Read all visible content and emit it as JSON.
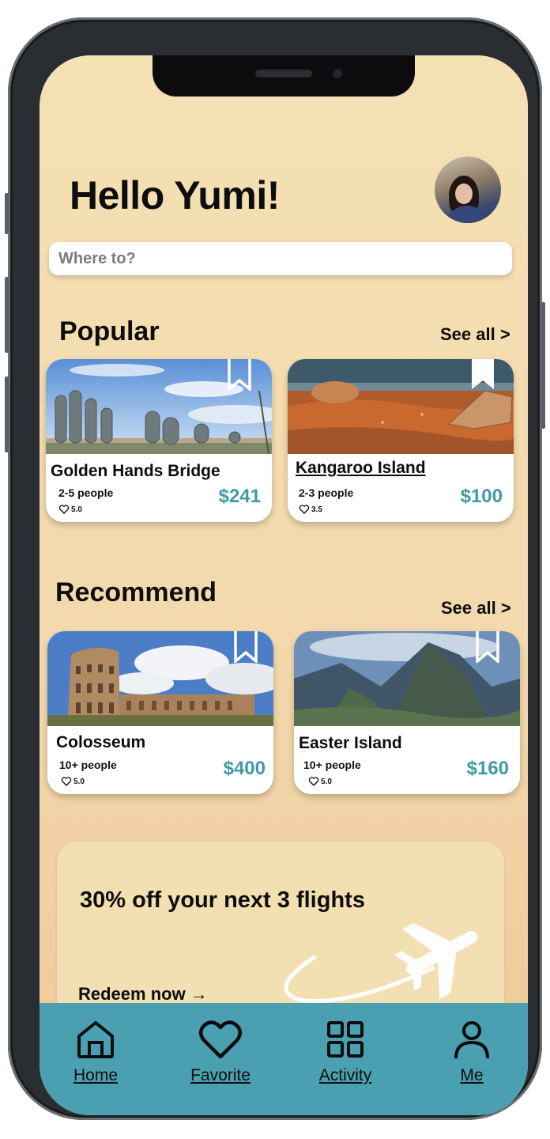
{
  "header": {
    "greeting": "Hello Yumi!"
  },
  "search": {
    "placeholder": "Where to?"
  },
  "popular": {
    "title": "Popular",
    "see_all": "See all >",
    "cards": [
      {
        "name": "Golden Hands Bridge",
        "people": "2-5 people",
        "rating": "5.0",
        "price": "$241"
      },
      {
        "name": "Kangaroo Island",
        "people": "2-3 people",
        "rating": "3.5",
        "price": "$100"
      }
    ]
  },
  "recommend": {
    "title": "Recommend",
    "see_all": "See all >",
    "cards": [
      {
        "name": "Colosseum",
        "people": "10+ people",
        "rating": "5.0",
        "price": "$400"
      },
      {
        "name": "Easter Island",
        "people": "10+ people",
        "rating": "5.0",
        "price": "$160"
      }
    ]
  },
  "promo": {
    "title": "30% off your next 3 flights",
    "cta": "Redeem now →"
  },
  "tabbar": {
    "items": [
      {
        "label": "Home",
        "icon": "home-icon"
      },
      {
        "label": "Favorite",
        "icon": "heart-icon"
      },
      {
        "label": "Activity",
        "icon": "grid-icon"
      },
      {
        "label": "Me",
        "icon": "user-icon"
      }
    ]
  },
  "colors": {
    "background": "#f4e1b4",
    "accent_teal": "#4a9fb0",
    "price": "#3f9aa7",
    "card": "#ffffff"
  }
}
